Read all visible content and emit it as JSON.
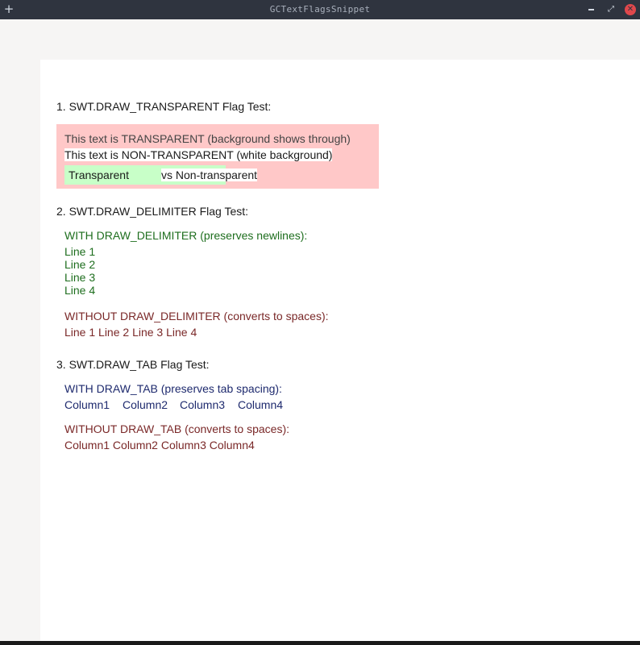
{
  "window": {
    "title": "GCTextFlagsSnippet",
    "buttons": {
      "new": "+",
      "minimize": "",
      "maximize": "⤢",
      "close": "✕"
    }
  },
  "colors": {
    "pink_background": "#ffc8c8",
    "green_background": "#c8ffc8",
    "green_text": "#1e6e1e",
    "maroon_text": "#7a2828",
    "navy_text": "#1e2a6e"
  },
  "sections": {
    "transparent": {
      "heading": "1. SWT.DRAW_TRANSPARENT Flag Test:",
      "line_transparent": "This text is TRANSPARENT (background shows through)",
      "line_non_transparent": "This text is NON-TRANSPARENT (white background)",
      "mixed_transparent": "Transparent",
      "mixed_non_transparent": "vs Non-transparent"
    },
    "delimiter": {
      "heading": "2. SWT.DRAW_DELIMITER Flag Test:",
      "with_label": "WITH DRAW_DELIMITER (preserves newlines):",
      "with_lines": [
        "Line 1",
        "Line 2",
        "Line 3",
        "Line 4"
      ],
      "without_label": "WITHOUT DRAW_DELIMITER (converts to spaces):",
      "without_text": "Line 1 Line 2 Line 3 Line 4"
    },
    "tab": {
      "heading": "3. SWT.DRAW_TAB Flag Test:",
      "with_label": "WITH DRAW_TAB (preserves tab spacing):",
      "with_columns": [
        "Column1",
        "Column2",
        "Column3",
        "Column4"
      ],
      "without_label": "WITHOUT DRAW_TAB (converts to spaces):",
      "without_text": "Column1 Column2 Column3 Column4"
    }
  }
}
